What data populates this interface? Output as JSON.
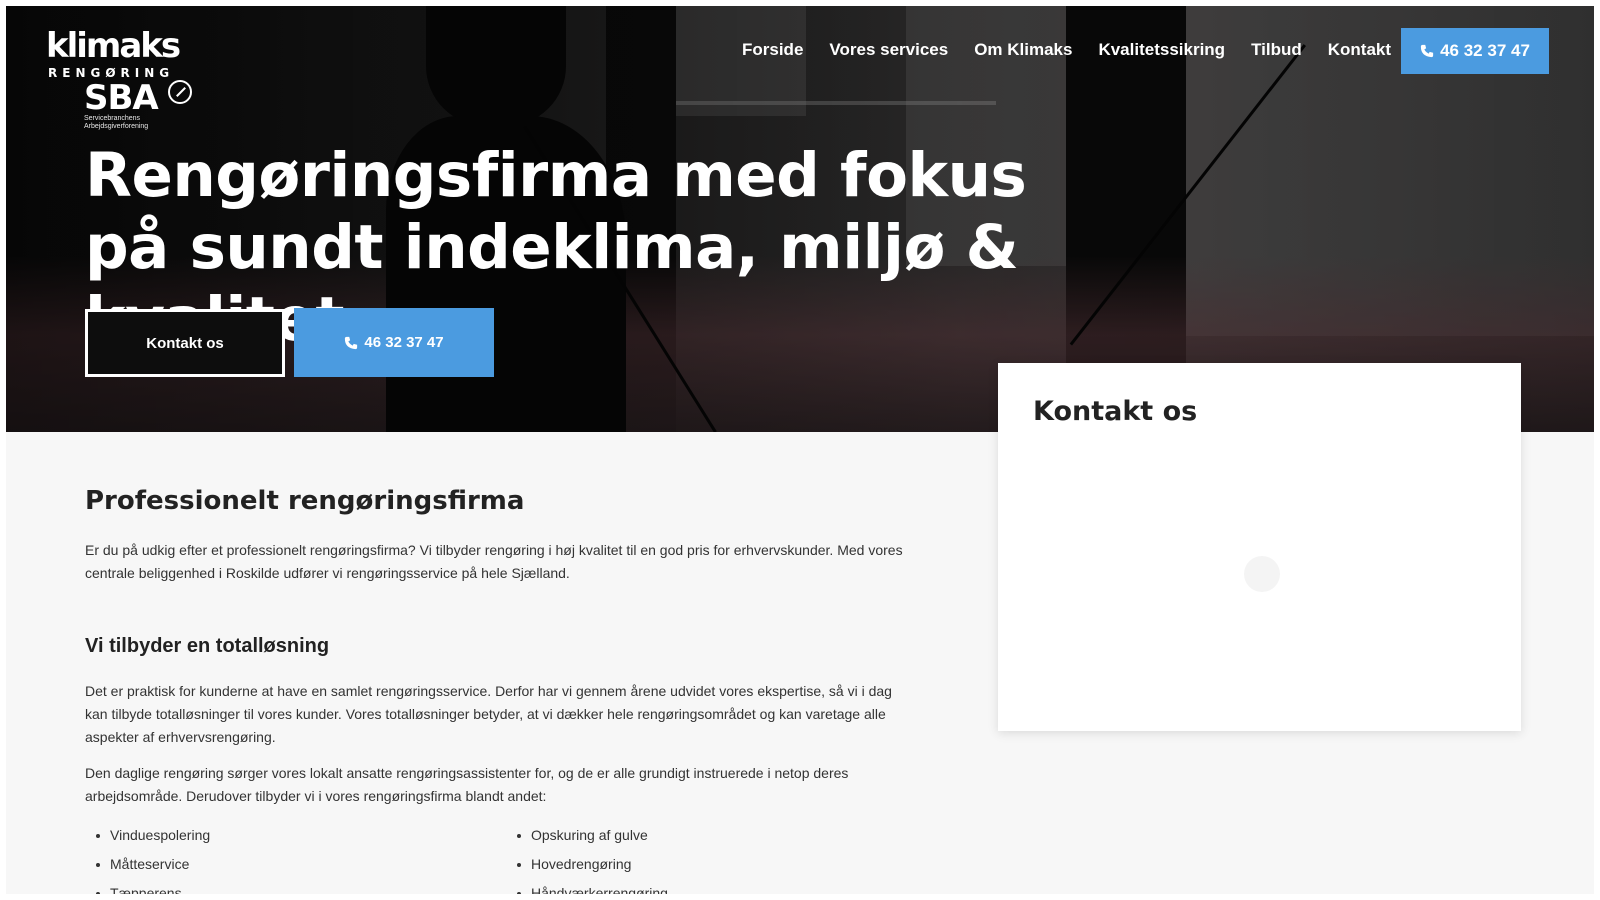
{
  "logo": {
    "wordmark": "klimaks",
    "subtitle": "RENGØRING",
    "badge": "SBA",
    "badge_caption": "Servicebranchens Arbejdsgiverforening"
  },
  "nav": {
    "items": [
      "Forside",
      "Vores services",
      "Om Klimaks",
      "Kvalitetssikring",
      "Tilbud",
      "Kontakt"
    ],
    "phone": "46 32 37 47"
  },
  "hero": {
    "headline": "Rengøringsfirma med fokus på sundt indeklima, miljø & kvalitet.",
    "contact_button": "Kontakt os",
    "phone_button": "46 32 37 47"
  },
  "contact_card": {
    "title": "Kontakt os"
  },
  "content": {
    "heading": "Professionelt rengøringsfirma",
    "intro": "Er du på udkig efter et professionelt rengøringsfirma? Vi tilbyder rengøring i høj kvalitet til en god pris for erhvervskunder. Med vores centrale beliggenhed i Roskilde udfører vi rengøringsservice på hele Sjælland.",
    "subheading": "Vi tilbyder en totalløsning",
    "para1": "Det er praktisk for kunderne at have en samlet rengøringsservice. Derfor har vi gennem årene udvidet vores ekspertise, så vi i dag kan tilbyde totalløsninger til vores kunder. Vores totalløsninger betyder, at vi dækker hele rengøringsområdet og kan varetage alle aspekter af erhvervsrengøring.",
    "para2": "Den daglige rengøring sørger vores lokalt ansatte rengøringsassistenter for, og de er alle grundigt instruerede i netop deres arbejdsområde. Derudover tilbyder vi i vores rengøringsfirma blandt andet:",
    "services_left": [
      "Vinduespolering",
      "Måtteservice",
      "Tæpperens"
    ],
    "services_right": [
      "Opskuring af gulve",
      "Hovedrengøring",
      "Håndværkerrengøring"
    ]
  },
  "colors": {
    "accent": "#4b9be0",
    "text": "#222222",
    "background": "#f7f7f7"
  }
}
